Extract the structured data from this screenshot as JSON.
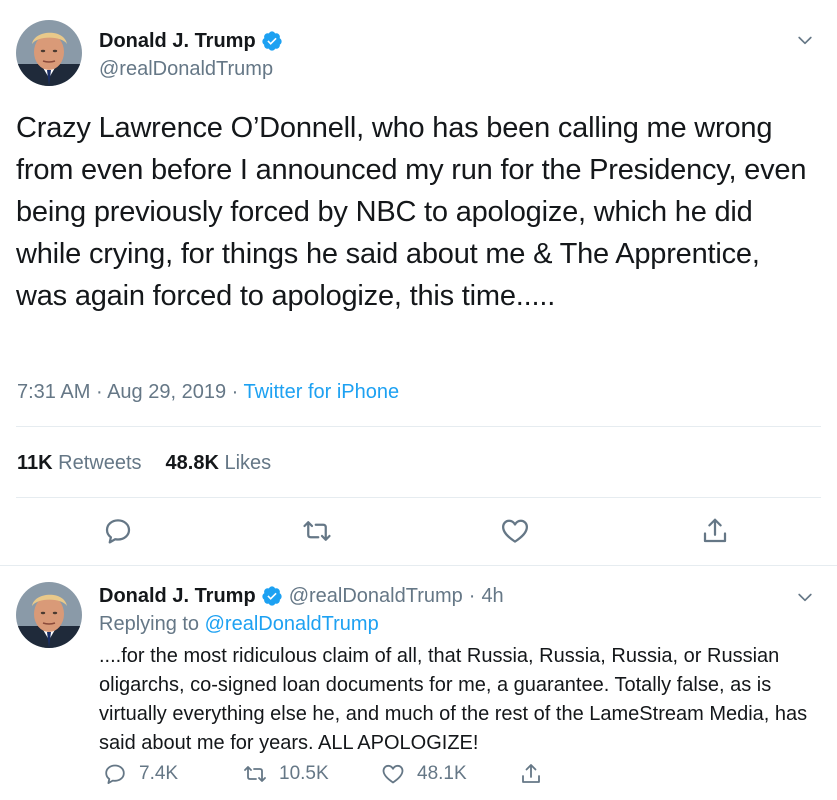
{
  "main": {
    "author_name": "Donald J. Trump",
    "handle": "@realDonaldTrump",
    "text": "Crazy Lawrence O’Donnell, who has been calling me wrong from even before I announced my run for the Presidency, even being previously forced by NBC to apologize, which he did while crying, for things he said about me & The Apprentice, was again forced to apologize, this time.....",
    "time": "7:31 AM",
    "date": "Aug 29, 2019",
    "source": "Twitter for iPhone",
    "retweets_count": "11K",
    "retweets_label": "Retweets",
    "likes_count": "48.8K",
    "likes_label": "Likes"
  },
  "reply": {
    "author_name": "Donald J. Trump",
    "handle": "@realDonaldTrump",
    "time": "4h",
    "replying_prefix": "Replying to",
    "replying_to": "@realDonaldTrump",
    "text": "....for the most ridiculous claim of all, that Russia, Russia, Russia, or Russian oligarchs, co-signed loan documents for me, a guarantee. Totally false, as is virtually everything else he, and much of the rest of the LameStream Media, has said about me for years. ALL APOLOGIZE!",
    "reply_count": "7.4K",
    "retweet_count": "10.5K",
    "like_count": "48.1K"
  },
  "colors": {
    "accent": "#1da1f2",
    "secondary_text": "#657786",
    "primary_text": "#14171a",
    "divider": "#e6ecf0"
  },
  "icons": [
    "verified-badge-icon",
    "chevron-down-icon",
    "reply-icon",
    "retweet-icon",
    "like-icon",
    "share-icon"
  ]
}
